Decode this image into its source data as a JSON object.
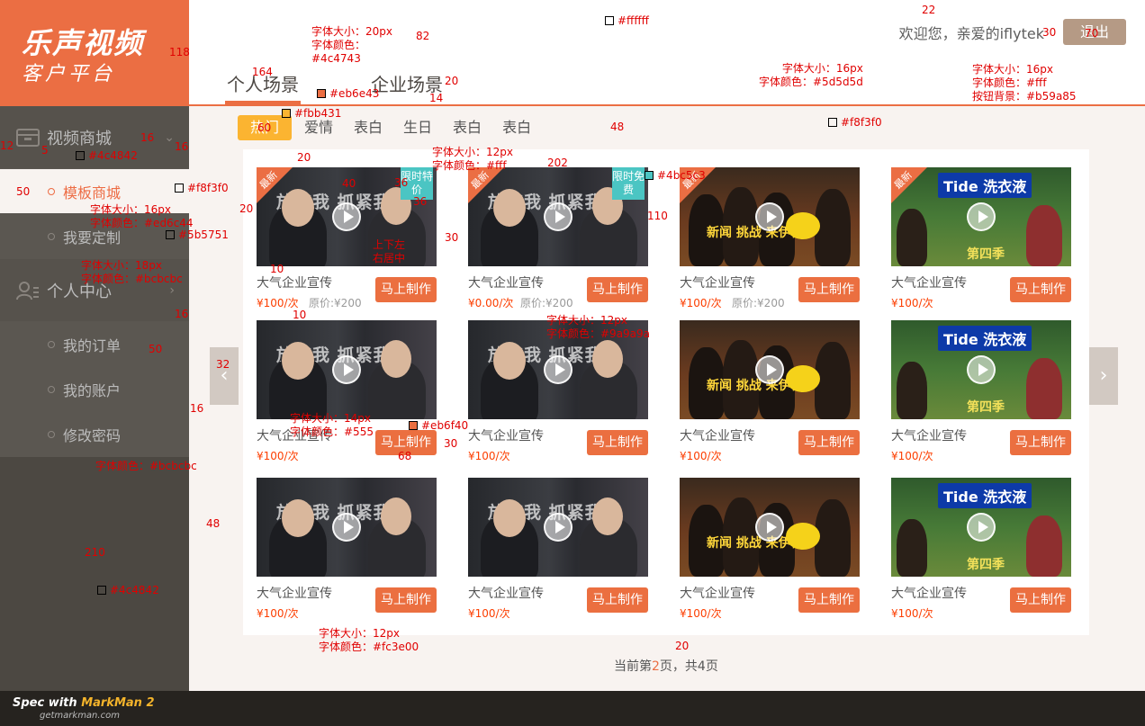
{
  "logo": {
    "main": "乐声视频",
    "sub": "客户平台"
  },
  "header": {
    "tabs": [
      {
        "label": "个人场景",
        "active": true
      },
      {
        "label": "企业场景",
        "active": false
      }
    ],
    "welcome": "欢迎您，亲爱的iflytek",
    "logout": "退出"
  },
  "sidebar": {
    "groups": [
      {
        "label": "视频商城",
        "icon": "shop-icon",
        "items": [
          {
            "label": "模板商城",
            "active": true
          },
          {
            "label": "我要定制",
            "active": false
          }
        ]
      },
      {
        "label": "个人中心",
        "icon": "user-center-icon",
        "items": [
          {
            "label": "我的订单",
            "active": false
          },
          {
            "label": "我的账户",
            "active": false
          },
          {
            "label": "修改密码",
            "active": false
          }
        ]
      }
    ]
  },
  "categories": [
    {
      "label": "热门",
      "active": true
    },
    {
      "label": "爱情",
      "active": false
    },
    {
      "label": "表白",
      "active": false
    },
    {
      "label": "生日",
      "active": false
    },
    {
      "label": "表白",
      "active": false
    },
    {
      "label": "表白",
      "active": false
    }
  ],
  "cards": [
    {
      "image": "couple",
      "title": "大气企业宣传",
      "price": "¥100/次",
      "original": "原价:¥200",
      "corner": "最新",
      "promo": "限时特价",
      "button": "马上制作"
    },
    {
      "image": "couple",
      "title": "大气企业宣传",
      "price": "¥0.00/次",
      "original": "原价:¥200",
      "corner": "最新",
      "promo": "限时免费",
      "button": "马上制作"
    },
    {
      "image": "group",
      "title": "大气企业宣传",
      "price": "¥100/次",
      "original": "原价:¥200",
      "corner": "最新",
      "promo": "",
      "button": "马上制作"
    },
    {
      "image": "forest",
      "title": "大气企业宣传",
      "price": "¥100/次",
      "original": "",
      "corner": "最新",
      "promo": "",
      "button": "马上制作"
    },
    {
      "image": "couple",
      "title": "大气企业宣传",
      "price": "¥100/次",
      "original": "",
      "corner": "",
      "promo": "",
      "button": "马上制作"
    },
    {
      "image": "couple",
      "title": "大气企业宣传",
      "price": "¥100/次",
      "original": "",
      "corner": "",
      "promo": "",
      "button": "马上制作"
    },
    {
      "image": "group",
      "title": "大气企业宣传",
      "price": "¥100/次",
      "original": "",
      "corner": "",
      "promo": "",
      "button": "马上制作"
    },
    {
      "image": "forest",
      "title": "大气企业宣传",
      "price": "¥100/次",
      "original": "",
      "corner": "",
      "promo": "",
      "button": "马上制作"
    },
    {
      "image": "couple",
      "title": "大气企业宣传",
      "price": "¥100/次",
      "original": "",
      "corner": "",
      "promo": "",
      "button": "马上制作"
    },
    {
      "image": "couple",
      "title": "大气企业宣传",
      "price": "¥100/次",
      "original": "",
      "corner": "",
      "promo": "",
      "button": "马上制作"
    },
    {
      "image": "group",
      "title": "大气企业宣传",
      "price": "¥100/次",
      "original": "",
      "corner": "",
      "promo": "",
      "button": "马上制作"
    },
    {
      "image": "forest",
      "title": "大气企业宣传",
      "price": "¥100/次",
      "original": "",
      "corner": "",
      "promo": "",
      "button": "马上制作"
    }
  ],
  "thumb_text": {
    "couple_banner": "放弃我 抓紧我",
    "tide": "Tide 洗衣液",
    "group_show": "新闻 挑战 来伊份",
    "forest_sub": "第四季"
  },
  "pagination": {
    "before": "当前第",
    "current": "2",
    "after": "页，共4页"
  },
  "nav_arrows": {
    "prev": "‹",
    "next": "›"
  },
  "spec_notes": {
    "tab_font": "字体大小：20px\n字体颜色：\n#4c4743",
    "white": "#ffffff",
    "welcome_font": "字体大小：16px\n字体颜色：#5d5d5d",
    "button_font": "字体大小：16px\n字体颜色：#fff\n按钮背景：#b59a85",
    "tab_underline": "#eb6e43",
    "hot_bg": "#fbb431",
    "content_bg": "#f8f3f0",
    "sidebar_bg": "#4c4842",
    "sub_active_bg": "#f8f3f0",
    "active_font": "字体大小：16px\n字体颜色：#ed6c44",
    "sub_bg": "#5b5751",
    "group_font": "字体大小：18px\n字体颜色：#bcbcbc",
    "promo_font": "字体大小：12px\n字体颜色：#fff",
    "promo_color": "#4bc5c3",
    "orig_font": "字体大小：12px\n字体颜色：#9a9a9a",
    "play_pos": "上下左\n右居中",
    "title_font": "字体大小：14px\n字体颜色：#555",
    "btn_color": "#eb6f40",
    "sub_font": "字体颜色：#bcbcbc",
    "sidebar_bg2": "#4c4842",
    "price_font": "字体大小：12px\n字体颜色：#fc3e00",
    "dims": [
      "118",
      "164",
      "82",
      "22",
      "30",
      "70",
      "20",
      "14",
      "48",
      "60",
      "40",
      "36",
      "36",
      "202",
      "110",
      "20",
      "30",
      "10",
      "10",
      "50",
      "32",
      "16",
      "68",
      "30",
      "48",
      "210",
      "20",
      "12",
      "5",
      "50",
      "16",
      "16",
      "16",
      "20"
    ]
  },
  "footer": {
    "brand_prefix": "Spec with ",
    "brand_name": "MarkMan 2",
    "url": "getmarkman.com"
  }
}
